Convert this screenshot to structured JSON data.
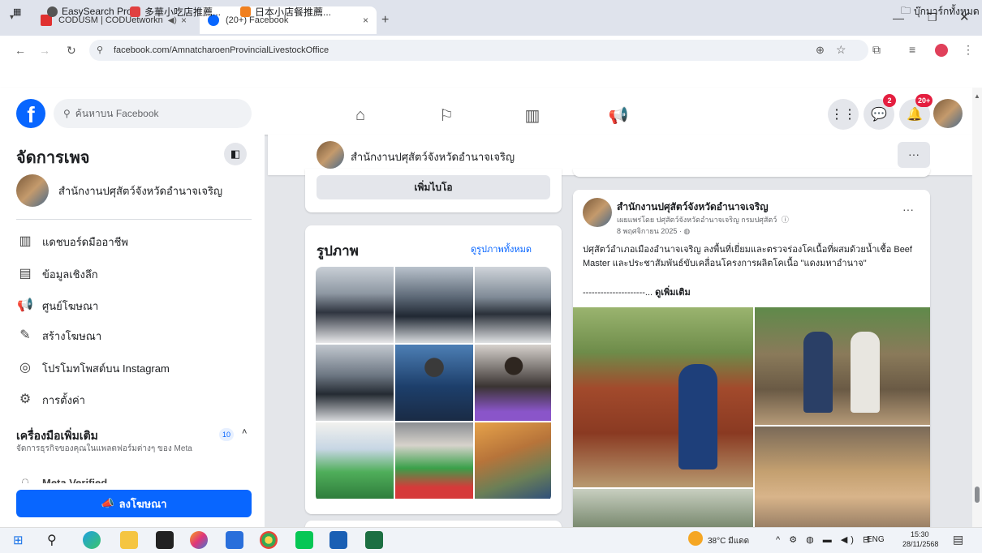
{
  "browser": {
    "tabs": [
      {
        "label": "CODUSM | CODUetworkn",
        "active": false
      },
      {
        "label": "(20+) Facebook",
        "active": true
      }
    ],
    "url": "facebook.com/AmnatcharoenProvincialLivestockOffice",
    "bookmarks": [
      "EasySearch Pro",
      "多華小吃店推薦...",
      "日本小店餐推薦..."
    ],
    "bookmarks_folder": "บุ๊กมาร์กทั้งหมด"
  },
  "fb_header": {
    "logo": "f",
    "search_placeholder": "ค้นหาบน Facebook",
    "messenger_badge": "2",
    "notifications_badge": "20+"
  },
  "sidebar": {
    "title": "จัดการเพจ",
    "page_name": "สำนักงานปศุสัตว์จังหวัดอำนาจเจริญ",
    "items": [
      {
        "label": "แดชบอร์ดมืออาชีพ",
        "icon": "dashboard-icon"
      },
      {
        "label": "ข้อมูลเชิงลึก",
        "icon": "insights-icon"
      },
      {
        "label": "ศูนย์โฆษณา",
        "icon": "megaphone-icon"
      },
      {
        "label": "สร้างโฆษณา",
        "icon": "edit-icon"
      },
      {
        "label": "โปรโมทโพสต์บน Instagram",
        "icon": "instagram-icon"
      },
      {
        "label": "การตั้งค่า",
        "icon": "gear-icon"
      }
    ],
    "tools_title": "เครื่องมือเพิ่มเติม",
    "tools_subtitle": "จัดการธุรกิจของคุณในแพลตฟอร์มต่างๆ ของ Meta",
    "tools_count": "10",
    "meta_verified": "Meta Verified",
    "ad_button": "ลงโฆษณา"
  },
  "page_bar": {
    "name": "สำนักงานปศุสัตว์จังหวัดอำนาจเจริญ",
    "more": "···"
  },
  "intro": {
    "add_bio": "เพิ่มไบโอ"
  },
  "photos": {
    "title": "รูปภาพ",
    "see_all": "ดูรูปภาพทั้งหมด"
  },
  "post": {
    "author": "สำนักงานปศุสัตว์จังหวัดอำนาจเจริญ",
    "posted_by": "เผยแพร่โดย ปศุสัตว์จังหวัดอำนาจเจริญ กรมปศุสัตว์",
    "date": "8 พฤศจิกายน 2025 · ",
    "text": "ปศุสัตว์อำเภอเมืองอำนาจเจริญ ลงพื้นที่เยี่ยมและตรวจร่องโคเนื้อที่ผสมด้วยน้ำเชื้อ Beef Master และประชาสัมพันธ์ขับเคลื่อนโครงการผลิตโคเนื้อ \"แดงมหาอำนาจ\"",
    "ellipsis": "---------------------... ",
    "see_more": "ดูเพิ่มเติม",
    "more": "···"
  },
  "taskbar": {
    "weather": "38°C มีแดด",
    "lang": "ENG",
    "time": "15:30",
    "date": "28/11/2568"
  },
  "colors": {
    "fb_blue": "#0866ff",
    "badge_red": "#e41e3f"
  }
}
